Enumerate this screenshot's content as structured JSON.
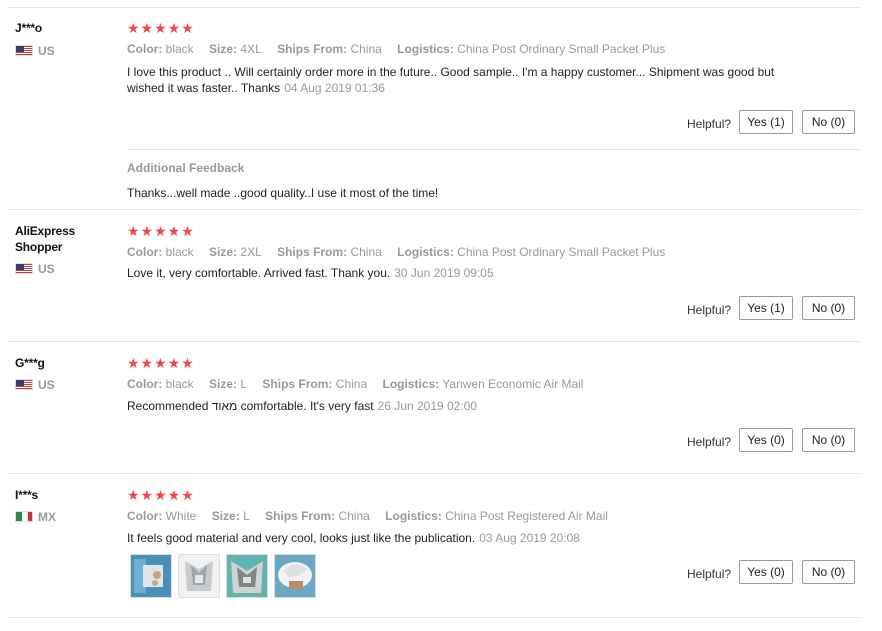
{
  "labels": {
    "color": "Color:",
    "size": "Size:",
    "ships_from": "Ships From:",
    "logistics": "Logistics:",
    "helpful": "Helpful?",
    "additional_feedback": "Additional Feedback"
  },
  "reviews": [
    {
      "name": "J***o",
      "country": "US",
      "rating": "★★★★★",
      "color": "black",
      "size": "4XL",
      "ships_from": "China",
      "logistics": "China Post Ordinary Small Packet Plus",
      "text": "I love this product .. Will certainly order more in the future.. Good sample.. I'm a happy customer... Shipment was good but wished it was faster.. Thanks",
      "date": "04 Aug 2019 01:36",
      "yes": "Yes (1)",
      "no": "No (0)",
      "additional_feedback": "Thanks...well made ..good quality..I use it most of the time!"
    },
    {
      "name": "AliExpress Shopper",
      "country": "US",
      "rating": "★★★★★",
      "color": "black",
      "size": "2XL",
      "ships_from": "China",
      "logistics": "China Post Ordinary Small Packet Plus",
      "text": "Love it, very comfortable. Arrived fast. Thank you.",
      "date": "30 Jun 2019 09:05",
      "yes": "Yes (1)",
      "no": "No (0)"
    },
    {
      "name": "G***g",
      "country": "US",
      "rating": "★★★★★",
      "color": "black",
      "size": "L",
      "ships_from": "China",
      "logistics": "Yanwen Economic Air Mail",
      "text": "Recommended מאוד comfortable. It's very fast",
      "date": "26 Jun 2019 02:00",
      "yes": "Yes (0)",
      "no": "No (0)"
    },
    {
      "name": "I***s",
      "country": "MX",
      "rating": "★★★★★",
      "color": "White",
      "size": "L",
      "ships_from": "China",
      "logistics": "China Post Registered Air Mail",
      "text": "It feels good material and very cool, looks just like the publication.",
      "date": "03 Aug 2019 20:08",
      "yes": "Yes (0)",
      "no": "No (0)"
    }
  ]
}
